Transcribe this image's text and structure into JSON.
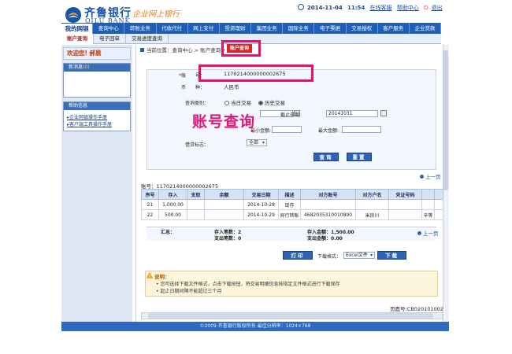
{
  "header": {
    "logo_cn": "齐鲁银行",
    "logo_en": "QILU BANK",
    "logo_sub": "企业网上银行",
    "date": "2014-11-04",
    "time": "11:54",
    "online_service": "在线客服",
    "help": "帮助中心",
    "logout": "退出"
  },
  "nav": {
    "items": [
      "我的网银",
      "查询中心",
      "转账业务",
      "代收代付",
      "网上支付",
      "投资理财",
      "集团业务",
      "国际业务",
      "电子票据",
      "交易授权",
      "客户服务",
      "企业贷款"
    ]
  },
  "subnav": {
    "items": [
      "账户查询",
      "电子回单",
      "交易进度查询"
    ]
  },
  "sidebar": {
    "welcome": "欢迎您! 郝晨",
    "news_title": "新消息",
    "news_count": "(0)",
    "help_title": "帮助信息",
    "help_links": [
      "企业网银操作手册",
      "客户端工具操作手册"
    ]
  },
  "breadcrumb": {
    "text": "当前位置：查询中心 > 账户查询 ▾",
    "tab": "账户查询"
  },
  "form": {
    "account_label": "账　　号：",
    "account_value": "1170214000000002675",
    "currency_label": "币　　种：",
    "currency_value": "人民币",
    "query_type_label": "查询类别：",
    "query_type_options": [
      "当日交易",
      "历史交易"
    ],
    "end_date_label": "截止日期:",
    "end_date_value": "20141031",
    "min_amount_label": "最小金额:",
    "max_amount_label": "最大金额:",
    "debit_credit_label": "借贷标志：",
    "debit_credit_value": "全部",
    "query_button": "查询",
    "reset_button": "重置"
  },
  "overlay_title": "账号查询",
  "pagination": {
    "prev": "上一页"
  },
  "result": {
    "account_line": "账号：1170214000000002675",
    "columns": [
      "序号",
      "存入",
      "支取",
      "余额",
      "交易日期",
      "描述",
      "对方账号",
      "对方户名",
      "凭证号码",
      "",
      ""
    ],
    "rows": [
      [
        "21",
        "1,000.00",
        "",
        "",
        "2014-10-28",
        "现存",
        "",
        "",
        "",
        "",
        ""
      ],
      [
        "22",
        "500.00",
        "",
        "",
        "2014-10-29",
        "异行转账",
        "4682035310010890",
        "米良川",
        "",
        "辛等",
        ""
      ]
    ],
    "summary_label": "汇总：",
    "deposit_count_label": "存入笔数：",
    "deposit_count": "2",
    "withdraw_count_label": "支出笔数：",
    "withdraw_count": "0",
    "deposit_amount_label": "存入金额：",
    "deposit_amount": "1,500.00",
    "withdraw_amount_label": "支出金额：",
    "withdraw_amount": "0.00"
  },
  "download": {
    "print_button": "打印",
    "format_label": "下载格式：",
    "format_value": "Excel文件",
    "download_button": "下载"
  },
  "note": {
    "title": "说明：",
    "lines": [
      "您可选择下载文件格式，点击下载按钮，将交易明细信息按指定文件格式进行下载保存",
      "起止日期间隔不能超过三个月"
    ]
  },
  "page_code": "页面号:CB020101002",
  "footer": "©2009 齐鲁银行版权所有  最佳分辨率：1024×768",
  "colors": {
    "brand_blue": "#1f5fb5",
    "highlight_pink": "#e8106a",
    "active_tab_red": "#d82525"
  }
}
